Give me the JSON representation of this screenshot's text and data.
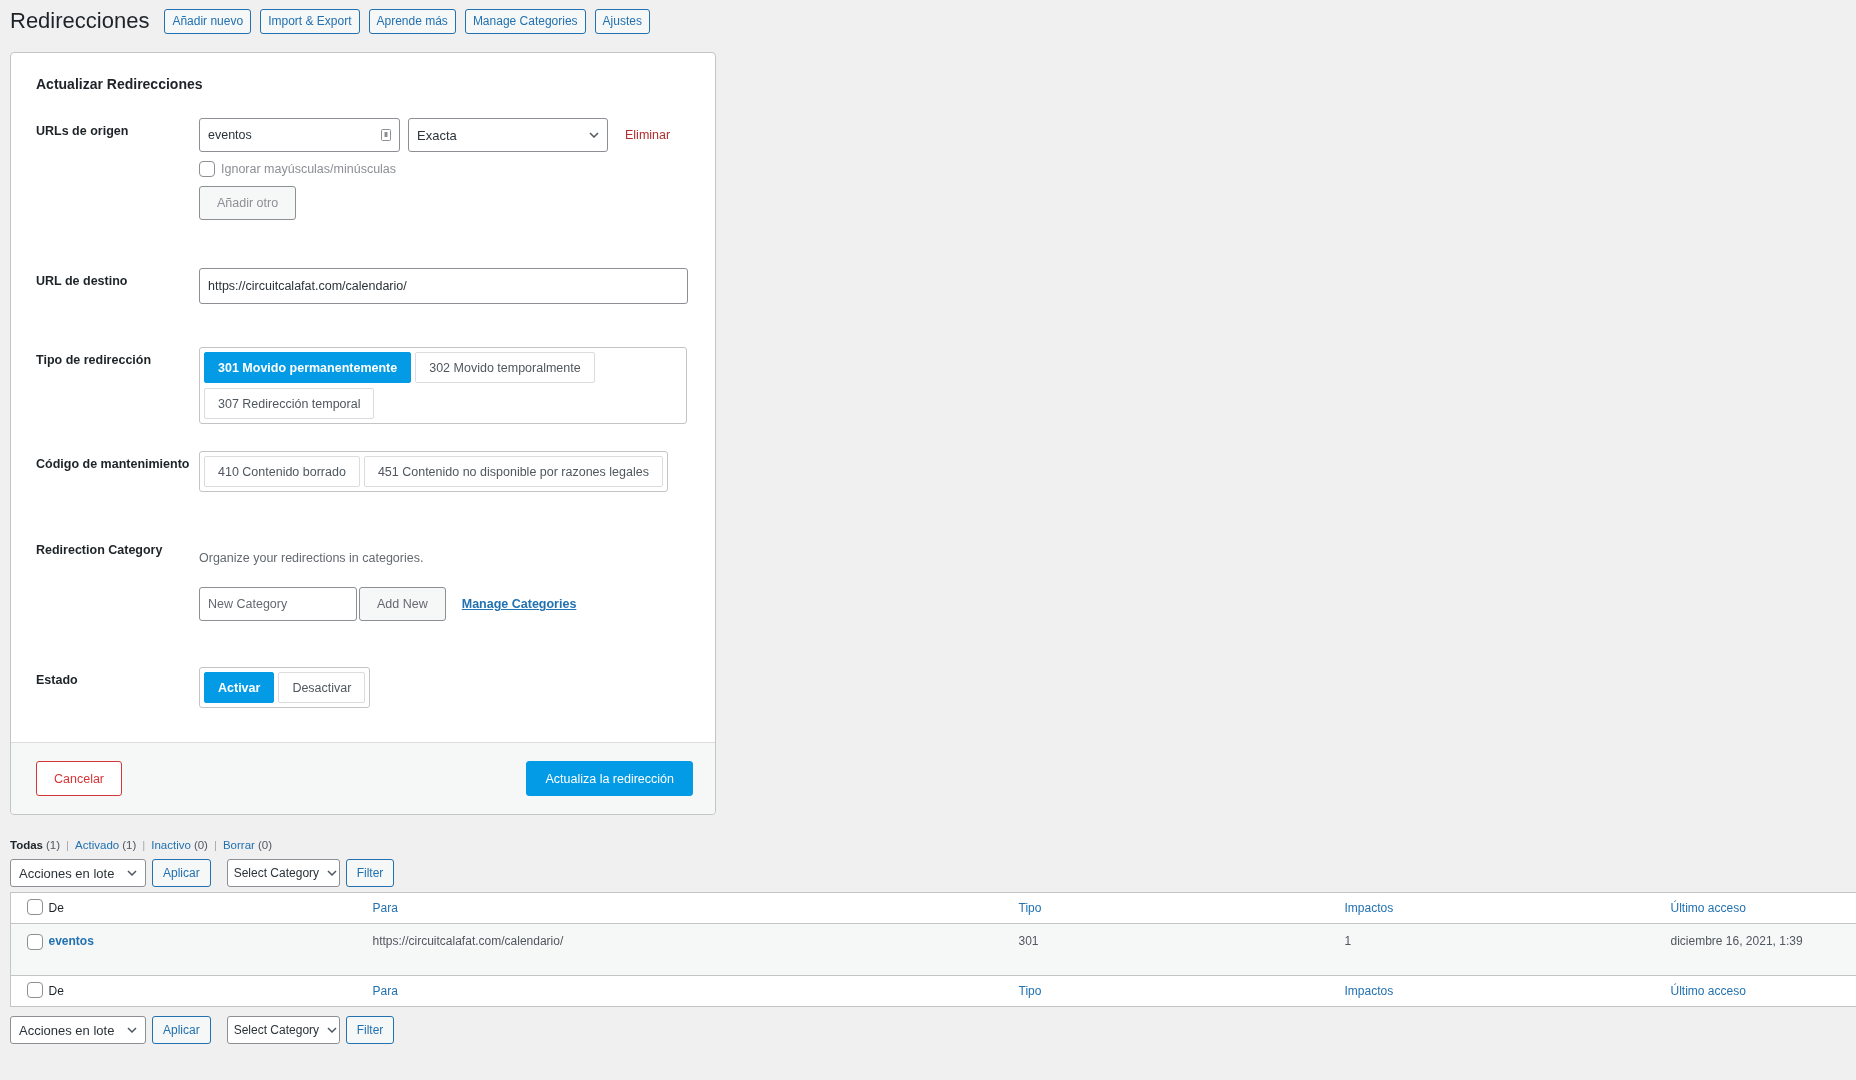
{
  "page": {
    "title": "Redirecciones",
    "header_buttons": [
      "Añadir nuevo",
      "Import & Export",
      "Aprende más",
      "Manage Categories",
      "Ajustes"
    ]
  },
  "form": {
    "title": "Actualizar Redirecciones",
    "source": {
      "label": "URLs de origen",
      "value": "eventos",
      "match": "Exacta",
      "remove": "Eliminar",
      "ignore_case": {
        "label": "Ignorar mayúsculas/minúsculas",
        "checked": false
      },
      "add_button": "Añadir otro"
    },
    "target": {
      "label": "URL de destino",
      "value": "https://circuitcalafat.com/calendario/"
    },
    "redirect_type": {
      "label": "Tipo de redirección",
      "options": [
        {
          "label": "301 Movido permanentemente",
          "selected": true
        },
        {
          "label": "302 Movido temporalmente",
          "selected": false
        },
        {
          "label": "307 Redirección temporal",
          "selected": false
        }
      ]
    },
    "maintenance": {
      "label": "Código de mantenimiento",
      "options": [
        {
          "label": "410 Contenido borrado",
          "selected": false
        },
        {
          "label": "451 Contenido no disponible por razones legales",
          "selected": false
        }
      ]
    },
    "category": {
      "label": "Redirection Category",
      "hint": "Organize your redirections in categories.",
      "placeholder": "New Category",
      "add_button": "Add New",
      "link": "Manage Categories"
    },
    "status": {
      "label": "Estado",
      "options": [
        {
          "label": "Activar",
          "selected": true
        },
        {
          "label": "Desactivar",
          "selected": false
        }
      ]
    },
    "cancel": "Cancelar",
    "submit": "Actualiza la redirección"
  },
  "filters": [
    {
      "label": "Todas",
      "count": "(1)",
      "selected": true
    },
    {
      "separator": "|",
      "label": "Activado",
      "count": "(1)",
      "selected": false
    },
    {
      "separator": "|",
      "label": "Inactivo",
      "count": "(0)",
      "selected": false
    },
    {
      "separator": "|",
      "label": "Borrar",
      "count": "(0)",
      "selected": false
    }
  ],
  "toolbar_top": {
    "bulk": "Acciones en lote",
    "apply": "Aplicar",
    "category": "Select Category",
    "filter": "Filter"
  },
  "table": {
    "columns": [
      {
        "label": "De",
        "sortable": false
      },
      {
        "label": "Para",
        "sortable": true
      },
      {
        "label": "Tipo",
        "sortable": true
      },
      {
        "label": "Impactos",
        "sortable": true
      },
      {
        "label": "Último acceso",
        "sortable": true
      }
    ],
    "header_checked": false,
    "rows": [
      {
        "checked": false,
        "cells": [
          "eventos",
          "https://circuitcalafat.com/calendario/",
          "301",
          "1",
          "diciembre 16, 2021, 1:39"
        ]
      }
    ],
    "footer_columns": [
      {
        "label": "De",
        "sortable": false
      },
      {
        "label": "Para",
        "sortable": true
      },
      {
        "label": "Tipo",
        "sortable": true
      },
      {
        "label": "Impactos",
        "sortable": true
      },
      {
        "label": "Último acceso",
        "sortable": true
      }
    ],
    "footer_checked": false
  },
  "toolbar_bottom": {
    "bulk": "Acciones en lote",
    "apply": "Aplicar",
    "category": "Select Category",
    "filter": "Filter"
  }
}
